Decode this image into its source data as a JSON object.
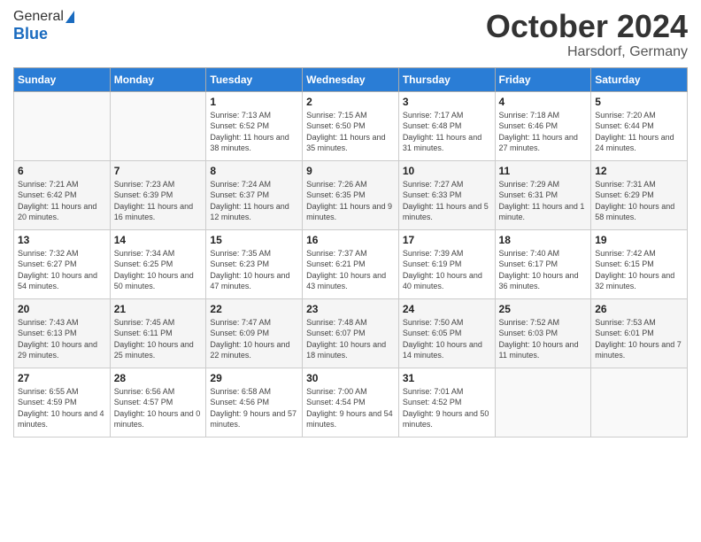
{
  "logo": {
    "line1": "General",
    "line2": "Blue"
  },
  "title": "October 2024",
  "subtitle": "Harsdorf, Germany",
  "days_header": [
    "Sunday",
    "Monday",
    "Tuesday",
    "Wednesday",
    "Thursday",
    "Friday",
    "Saturday"
  ],
  "weeks": [
    [
      {
        "num": "",
        "sunrise": "",
        "sunset": "",
        "daylight": ""
      },
      {
        "num": "",
        "sunrise": "",
        "sunset": "",
        "daylight": ""
      },
      {
        "num": "1",
        "sunrise": "Sunrise: 7:13 AM",
        "sunset": "Sunset: 6:52 PM",
        "daylight": "Daylight: 11 hours and 38 minutes."
      },
      {
        "num": "2",
        "sunrise": "Sunrise: 7:15 AM",
        "sunset": "Sunset: 6:50 PM",
        "daylight": "Daylight: 11 hours and 35 minutes."
      },
      {
        "num": "3",
        "sunrise": "Sunrise: 7:17 AM",
        "sunset": "Sunset: 6:48 PM",
        "daylight": "Daylight: 11 hours and 31 minutes."
      },
      {
        "num": "4",
        "sunrise": "Sunrise: 7:18 AM",
        "sunset": "Sunset: 6:46 PM",
        "daylight": "Daylight: 11 hours and 27 minutes."
      },
      {
        "num": "5",
        "sunrise": "Sunrise: 7:20 AM",
        "sunset": "Sunset: 6:44 PM",
        "daylight": "Daylight: 11 hours and 24 minutes."
      }
    ],
    [
      {
        "num": "6",
        "sunrise": "Sunrise: 7:21 AM",
        "sunset": "Sunset: 6:42 PM",
        "daylight": "Daylight: 11 hours and 20 minutes."
      },
      {
        "num": "7",
        "sunrise": "Sunrise: 7:23 AM",
        "sunset": "Sunset: 6:39 PM",
        "daylight": "Daylight: 11 hours and 16 minutes."
      },
      {
        "num": "8",
        "sunrise": "Sunrise: 7:24 AM",
        "sunset": "Sunset: 6:37 PM",
        "daylight": "Daylight: 11 hours and 12 minutes."
      },
      {
        "num": "9",
        "sunrise": "Sunrise: 7:26 AM",
        "sunset": "Sunset: 6:35 PM",
        "daylight": "Daylight: 11 hours and 9 minutes."
      },
      {
        "num": "10",
        "sunrise": "Sunrise: 7:27 AM",
        "sunset": "Sunset: 6:33 PM",
        "daylight": "Daylight: 11 hours and 5 minutes."
      },
      {
        "num": "11",
        "sunrise": "Sunrise: 7:29 AM",
        "sunset": "Sunset: 6:31 PM",
        "daylight": "Daylight: 11 hours and 1 minute."
      },
      {
        "num": "12",
        "sunrise": "Sunrise: 7:31 AM",
        "sunset": "Sunset: 6:29 PM",
        "daylight": "Daylight: 10 hours and 58 minutes."
      }
    ],
    [
      {
        "num": "13",
        "sunrise": "Sunrise: 7:32 AM",
        "sunset": "Sunset: 6:27 PM",
        "daylight": "Daylight: 10 hours and 54 minutes."
      },
      {
        "num": "14",
        "sunrise": "Sunrise: 7:34 AM",
        "sunset": "Sunset: 6:25 PM",
        "daylight": "Daylight: 10 hours and 50 minutes."
      },
      {
        "num": "15",
        "sunrise": "Sunrise: 7:35 AM",
        "sunset": "Sunset: 6:23 PM",
        "daylight": "Daylight: 10 hours and 47 minutes."
      },
      {
        "num": "16",
        "sunrise": "Sunrise: 7:37 AM",
        "sunset": "Sunset: 6:21 PM",
        "daylight": "Daylight: 10 hours and 43 minutes."
      },
      {
        "num": "17",
        "sunrise": "Sunrise: 7:39 AM",
        "sunset": "Sunset: 6:19 PM",
        "daylight": "Daylight: 10 hours and 40 minutes."
      },
      {
        "num": "18",
        "sunrise": "Sunrise: 7:40 AM",
        "sunset": "Sunset: 6:17 PM",
        "daylight": "Daylight: 10 hours and 36 minutes."
      },
      {
        "num": "19",
        "sunrise": "Sunrise: 7:42 AM",
        "sunset": "Sunset: 6:15 PM",
        "daylight": "Daylight: 10 hours and 32 minutes."
      }
    ],
    [
      {
        "num": "20",
        "sunrise": "Sunrise: 7:43 AM",
        "sunset": "Sunset: 6:13 PM",
        "daylight": "Daylight: 10 hours and 29 minutes."
      },
      {
        "num": "21",
        "sunrise": "Sunrise: 7:45 AM",
        "sunset": "Sunset: 6:11 PM",
        "daylight": "Daylight: 10 hours and 25 minutes."
      },
      {
        "num": "22",
        "sunrise": "Sunrise: 7:47 AM",
        "sunset": "Sunset: 6:09 PM",
        "daylight": "Daylight: 10 hours and 22 minutes."
      },
      {
        "num": "23",
        "sunrise": "Sunrise: 7:48 AM",
        "sunset": "Sunset: 6:07 PM",
        "daylight": "Daylight: 10 hours and 18 minutes."
      },
      {
        "num": "24",
        "sunrise": "Sunrise: 7:50 AM",
        "sunset": "Sunset: 6:05 PM",
        "daylight": "Daylight: 10 hours and 14 minutes."
      },
      {
        "num": "25",
        "sunrise": "Sunrise: 7:52 AM",
        "sunset": "Sunset: 6:03 PM",
        "daylight": "Daylight: 10 hours and 11 minutes."
      },
      {
        "num": "26",
        "sunrise": "Sunrise: 7:53 AM",
        "sunset": "Sunset: 6:01 PM",
        "daylight": "Daylight: 10 hours and 7 minutes."
      }
    ],
    [
      {
        "num": "27",
        "sunrise": "Sunrise: 6:55 AM",
        "sunset": "Sunset: 4:59 PM",
        "daylight": "Daylight: 10 hours and 4 minutes."
      },
      {
        "num": "28",
        "sunrise": "Sunrise: 6:56 AM",
        "sunset": "Sunset: 4:57 PM",
        "daylight": "Daylight: 10 hours and 0 minutes."
      },
      {
        "num": "29",
        "sunrise": "Sunrise: 6:58 AM",
        "sunset": "Sunset: 4:56 PM",
        "daylight": "Daylight: 9 hours and 57 minutes."
      },
      {
        "num": "30",
        "sunrise": "Sunrise: 7:00 AM",
        "sunset": "Sunset: 4:54 PM",
        "daylight": "Daylight: 9 hours and 54 minutes."
      },
      {
        "num": "31",
        "sunrise": "Sunrise: 7:01 AM",
        "sunset": "Sunset: 4:52 PM",
        "daylight": "Daylight: 9 hours and 50 minutes."
      },
      {
        "num": "",
        "sunrise": "",
        "sunset": "",
        "daylight": ""
      },
      {
        "num": "",
        "sunrise": "",
        "sunset": "",
        "daylight": ""
      }
    ]
  ]
}
